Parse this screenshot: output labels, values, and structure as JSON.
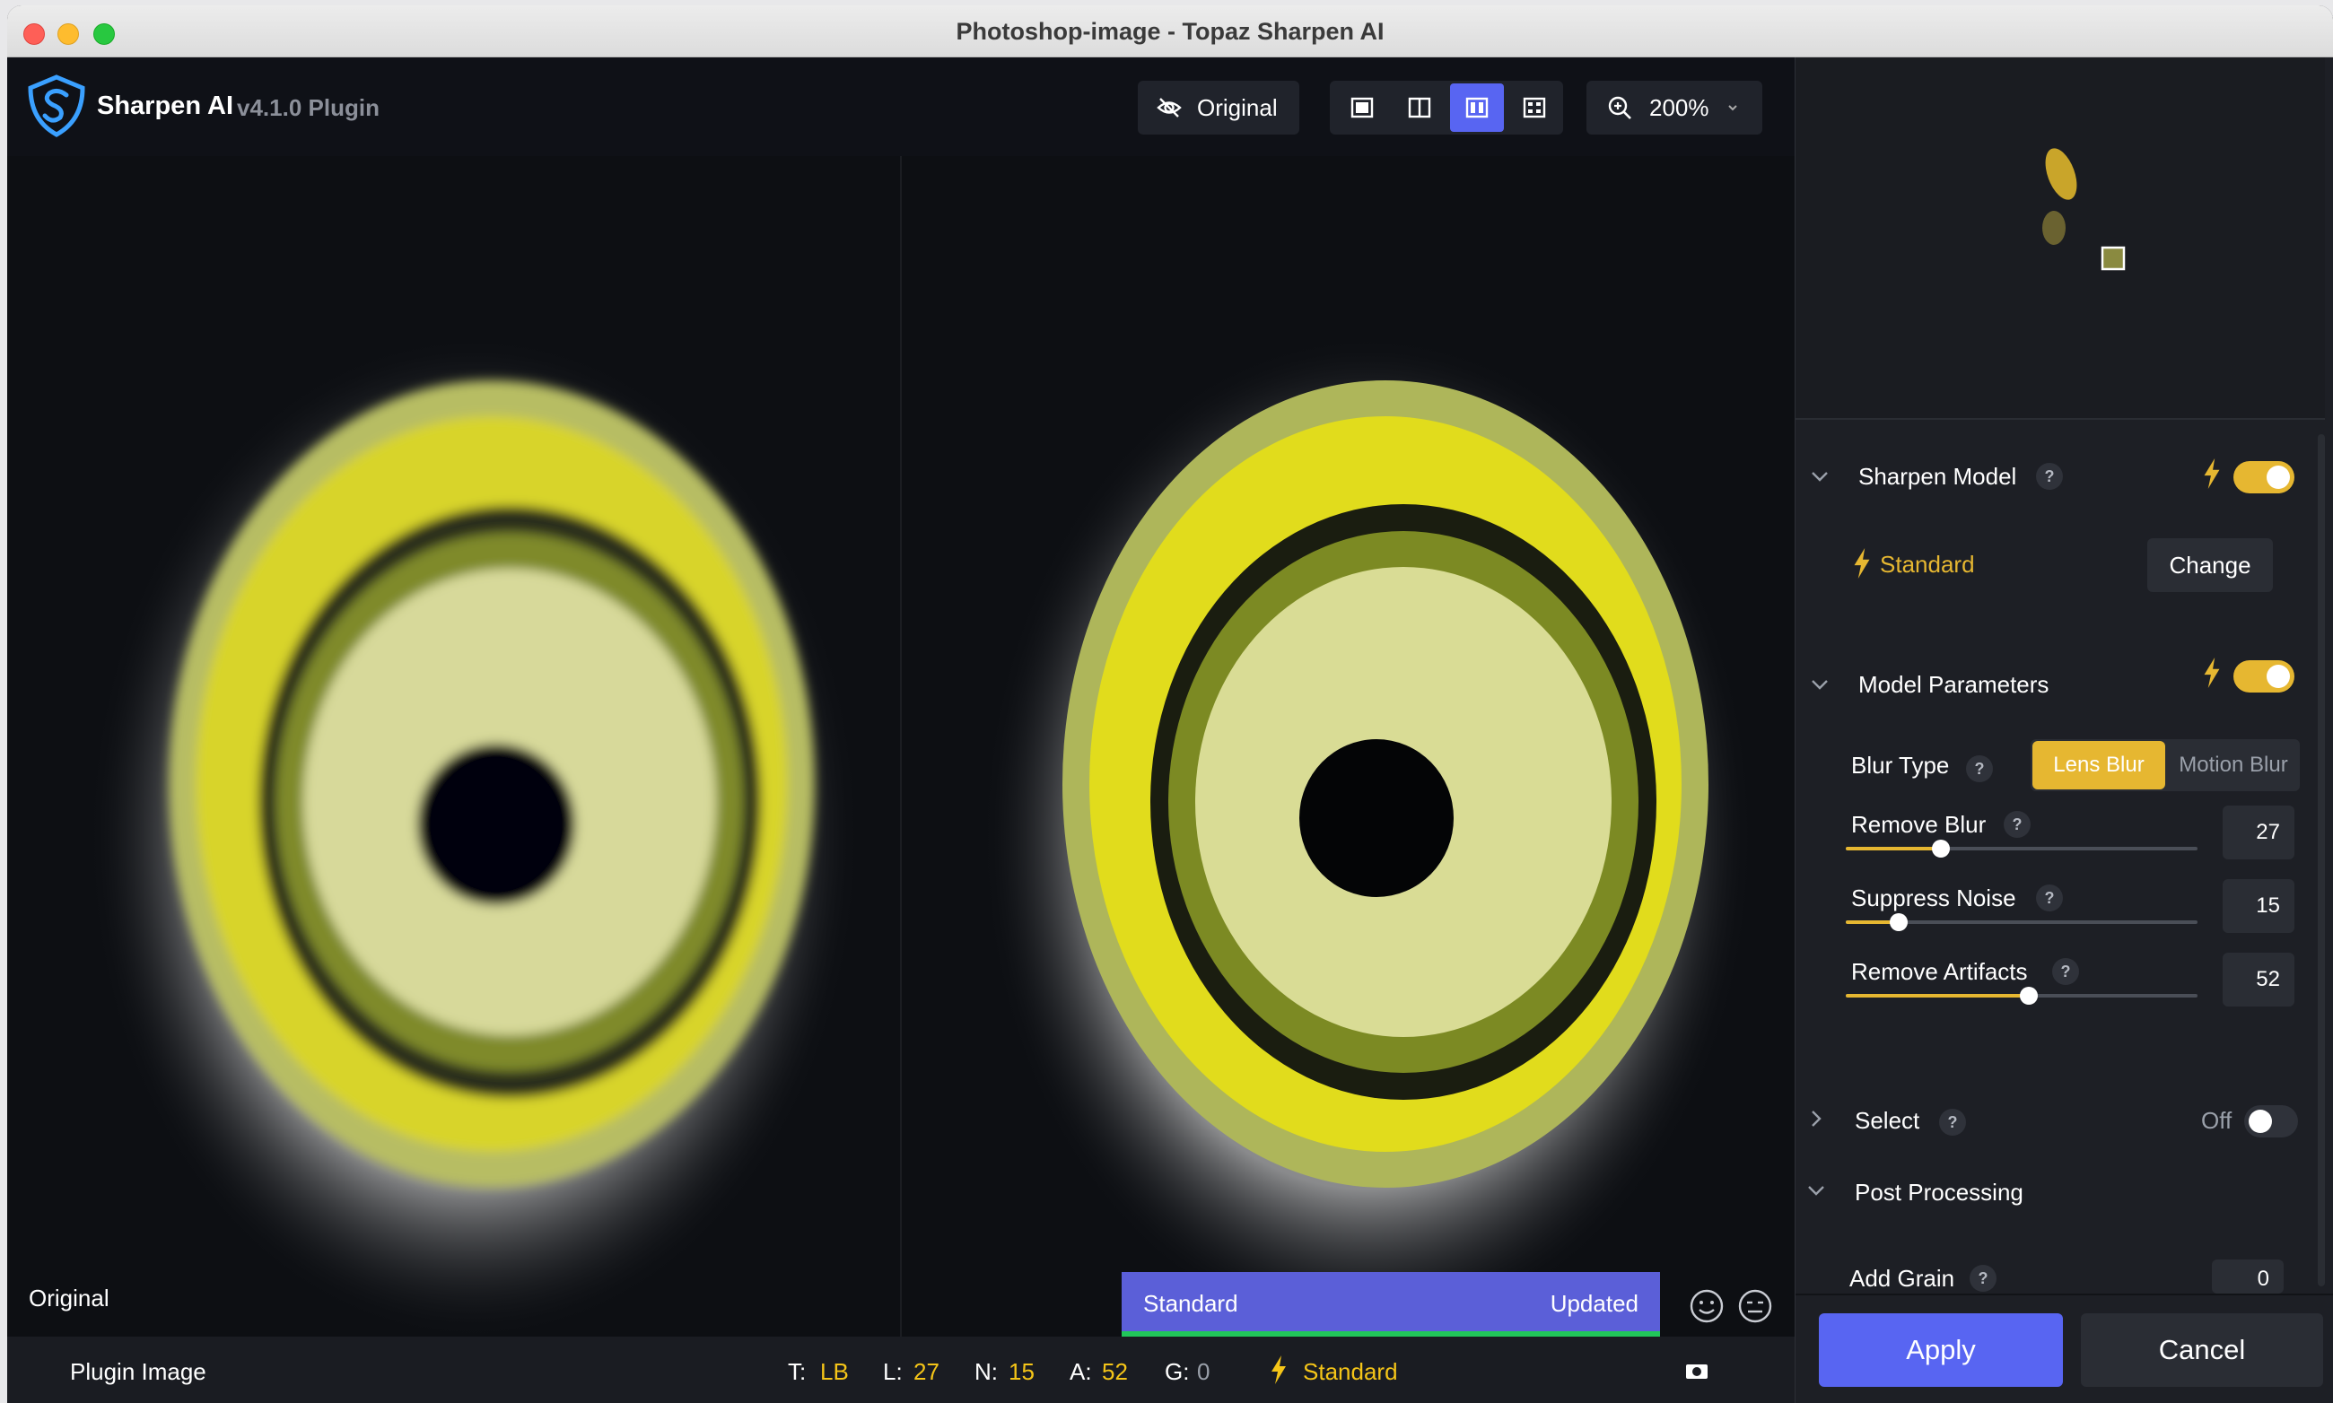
{
  "window": {
    "title": "Photoshop-image - Topaz Sharpen AI"
  },
  "header": {
    "app_name": "Sharpen AI",
    "version": "v4.1.0 Plugin",
    "original_label": "Original",
    "zoom_label": "200%",
    "view_modes": [
      "single-view-icon",
      "split-view-icon",
      "side-by-side-view-icon",
      "comparison-view-icon"
    ],
    "active_view": "side-by-side-view-icon"
  },
  "preview": {
    "left_label": "Original",
    "model_name": "Standard",
    "status": "Updated",
    "accent_color": "#5b5fd8",
    "progress_color": "#21c65a"
  },
  "bottombar": {
    "source": "Plugin Image",
    "t_key": "T:",
    "t_val": "LB",
    "l_key": "L:",
    "l_val": "27",
    "n_key": "N:",
    "n_val": "15",
    "a_key": "A:",
    "a_val": "52",
    "g_key": "G:",
    "g_val": "0",
    "model": "Standard"
  },
  "sidebar": {
    "sharpen_model": {
      "title": "Sharpen Model",
      "enabled": true,
      "model": "Standard",
      "change_label": "Change"
    },
    "model_params": {
      "title": "Model Parameters",
      "enabled": true,
      "blur_type_label": "Blur Type",
      "blur_options": [
        "Lens Blur",
        "Motion Blur"
      ],
      "blur_selected": "Lens Blur",
      "remove_blur": {
        "label": "Remove Blur",
        "value": "27",
        "level": 27
      },
      "suppress_noise": {
        "label": "Suppress Noise",
        "value": "15",
        "level": 15
      },
      "remove_artifacts": {
        "label": "Remove Artifacts",
        "value": "52",
        "level": 52
      }
    },
    "select": {
      "title": "Select",
      "state": "Off"
    },
    "post_processing": {
      "title": "Post Processing",
      "add_grain_label": "Add Grain",
      "add_grain_value": "0"
    },
    "apply_label": "Apply",
    "cancel_label": "Cancel",
    "accent_color": "#e6b731",
    "primary_color": "#5865f2"
  }
}
